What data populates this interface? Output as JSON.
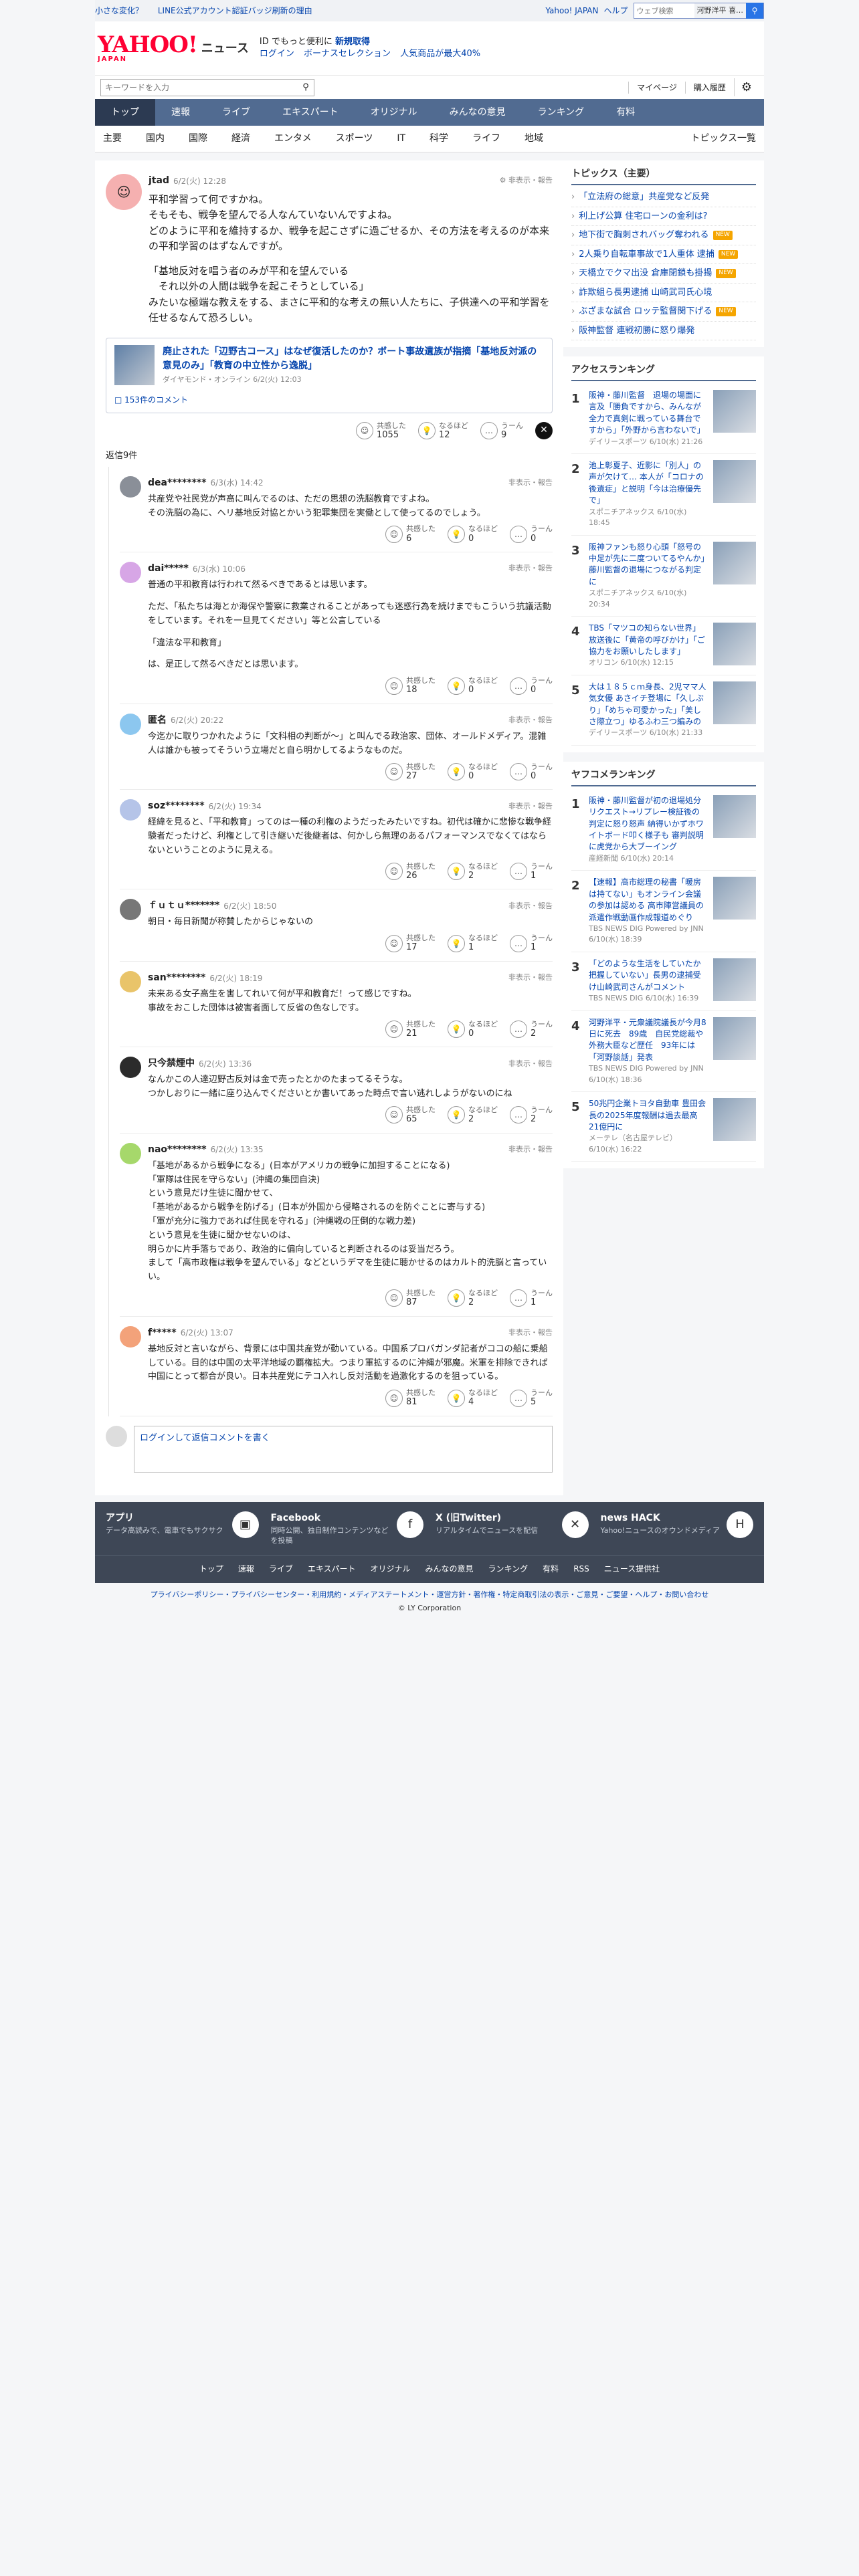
{
  "promo": {
    "left_links": [
      "小さな変化？",
      "LINE公式アカウント認証バッジ刷新の理由"
    ],
    "right_links": [
      "Yahoo! JAPAN",
      "ヘルプ"
    ],
    "search_placeholder": "ウェブ検索",
    "search_chip": "河野洋平 喜…"
  },
  "masthead": {
    "logo": "YAHOO!",
    "logo_sub": "JAPAN",
    "service": "ニュース",
    "line1_text": "ID でもっと便利に",
    "line1_link": "新規取得",
    "line2_login": "ログイン",
    "line2_bonus": "ボーナスセレクション",
    "line2_promo": "人気商品が最大40%"
  },
  "subbar": {
    "keyword_placeholder": "キーワードを入力",
    "mypage": "マイページ",
    "history": "購入履歴"
  },
  "gnav": [
    "トップ",
    "速報",
    "ライブ",
    "エキスパート",
    "オリジナル",
    "みんなの意見",
    "ランキング",
    "有料"
  ],
  "cnav": [
    "主要",
    "国内",
    "国際",
    "経済",
    "エンタメ",
    "スポーツ",
    "IT",
    "科学",
    "ライフ",
    "地域"
  ],
  "cnav_all": "トピックス一覧",
  "post": {
    "user": "jtad",
    "time": "6/2(火) 12:28",
    "report": "非表示・報告",
    "paragraphs": [
      "平和学習って何ですかね。",
      "そもそも、戦争を望んでる人なんていないんですよね。",
      "どのように平和を維持するか、戦争を起こさずに過ごせるか、その方法を考えるのが本来の平和学習のはずなんですが。",
      "",
      "「基地反対を唱う者のみが平和を望んでいる",
      "　それ以外の人間は戦争を起こそうとしている」",
      "みたいな極端な教えをする、まさに平和的な考えの無い人たちに、子供達への平和学習を任せるなんて恐ろしい。"
    ],
    "article": {
      "title": "廃止された「辺野古コース」はなぜ復活したのか？ボート事故遺族が指摘「基地反対派の意見のみ」「教育の中立性から逸脱」",
      "source": "ダイヤモンド・オンライン 6/2(火) 12:03",
      "comments": "153件のコメント"
    },
    "reactions": [
      {
        "label": "共感した",
        "count": "1055",
        "icon": "empathy-icon",
        "glyph": "☺"
      },
      {
        "label": "なるほど",
        "count": "12",
        "icon": "insight-icon",
        "glyph": "💡"
      },
      {
        "label": "うーん",
        "count": "9",
        "icon": "hmm-icon",
        "glyph": "…"
      }
    ]
  },
  "replies_heading": "返信9件",
  "replies": [
    {
      "user": "dea********",
      "time": "6/3(水) 14:42",
      "avatar_color": "#8a8f98",
      "lines": [
        "共産党や社民党が声高に叫んでるのは、ただの思想の洗脳教育ですよね。",
        "その洗脳の為に、ヘリ基地反対協とかいう犯罪集団を実働として使ってるのでしょう。"
      ],
      "r": [
        "6",
        "0",
        "0"
      ]
    },
    {
      "user": "dai*****",
      "time": "6/3(水) 10:06",
      "avatar_color": "#d7a6e6",
      "lines": [
        "普通の平和教育は行われて然るべきであるとは思います。",
        "",
        "ただ、「私たちは海とか海保や警察に救業されることがあっても迷惑行為を続けまでもこういう抗議活動をしています。それを一旦見てください」等と公言している",
        "",
        "「違法な平和教育」",
        "",
        "は、是正して然るべきだとは思います。"
      ],
      "r": [
        "18",
        "0",
        "0"
      ]
    },
    {
      "user": "匿名",
      "time": "6/2(火) 20:22",
      "avatar_color": "#8cc7ef",
      "lines": [
        "今迄かに取りつかれたように「文科相の判断が～」と叫んでる政治家、団体、オールドメディア。混雑人は誰かも被ってそういう立場だと自ら明かしてるようなものだ。"
      ],
      "r": [
        "27",
        "0",
        "0"
      ]
    },
    {
      "user": "soz********",
      "time": "6/2(火) 19:34",
      "avatar_color": "#b5c4e8",
      "lines": [
        "経緯を見ると、「平和教育」ってのは一種の利権のようだったみたいですね。初代は確かに悲惨な戦争経験者だったけど、利権として引き継いだ後継者は、何かしら無理のあるパフォーマンスでなくてはならないということのように見える。"
      ],
      "r": [
        "26",
        "2",
        "1"
      ]
    },
    {
      "user": "ｆｕｔｕ*******",
      "time": "6/2(火) 18:50",
      "avatar_color": "#777",
      "lines": [
        "朝日・毎日新聞が称賛したからじゃないの"
      ],
      "r": [
        "17",
        "1",
        "1"
      ]
    },
    {
      "user": "san********",
      "time": "6/2(火) 18:19",
      "avatar_color": "#e9c46a",
      "lines": [
        "未来ある女子高生を害してれいて何が平和教育だ！って感じですね。",
        "事故をおこした団体は被害者面して反省の色なしです。"
      ],
      "r": [
        "21",
        "0",
        "2"
      ]
    },
    {
      "user": "只今禁煙中",
      "time": "6/2(火) 13:36",
      "avatar_color": "#2b2b2b",
      "lines": [
        "なんかこの人達辺野古反対は金で売ったとかのたまってるそうな。",
        "つかしおりに一緒に座り込んでくださいとか書いてあった時点で言い逃れしようがないのにね"
      ],
      "r": [
        "65",
        "2",
        "2"
      ]
    },
    {
      "user": "nao********",
      "time": "6/2(火) 13:35",
      "avatar_color": "#a6d86b",
      "lines": [
        "「基地があるから戦争になる」(日本がアメリカの戦争に加担することになる)",
        "「軍隊は住民を守らない」(沖縄の集団自決)",
        "という意見だけ生徒に聞かせて、",
        "「基地があるから戦争を防げる」(日本が外国から侵略されるのを防ぐことに寄与する)",
        "「軍が充分に強力であれば住民を守れる」(沖縄戦の圧倒的な戦力差)",
        "という意見を生徒に聞かせないのは、",
        "明らかに片手落ちであり、政治的に偏向していると判断されるのは妥当だろう。",
        "まして「高市政権は戦争を望んでいる」などというデマを生徒に聴かせるのはカルト的洗脳と言っていい。"
      ],
      "r": [
        "87",
        "2",
        "1"
      ]
    },
    {
      "user": "f*****",
      "time": "6/2(火) 13:07",
      "avatar_color": "#f3a27a",
      "lines": [
        "基地反対と言いながら、背景には中国共産党が動いている。中国系プロパガンダ記者がココの船に乗船している。目的は中国の太平洋地域の覇権拡大。つまり軍拡するのに沖縄が邪魔。米軍を排除できれば中国にとって都合が良い。日本共産党にテコ入れし反対活動を過激化するのを狙っている。"
      ],
      "r": [
        "81",
        "4",
        "5"
      ]
    }
  ],
  "reply_labels": {
    "a": "共感した",
    "b": "なるほど",
    "c": "うーん"
  },
  "login_box": {
    "link": "ログイン",
    "text": "して返信コメントを書く"
  },
  "sidebar": {
    "topics_title": "トピックス（主要）",
    "topics": [
      {
        "t": "「立法府の総意」共産党など反発",
        "new": false
      },
      {
        "t": "利上げ公算 住宅ローンの金利は?",
        "new": false
      },
      {
        "t": "地下街で胸刺されバッグ奪われる",
        "new": true
      },
      {
        "t": "2人乗り自転車事故で1人重体 逮捕",
        "new": true
      },
      {
        "t": "天橋立でクマ出没 倉庫閉鎖も掛揚",
        "new": true
      },
      {
        "t": "詐欺組ら長男逮捕 山崎武司氏心境",
        "new": false
      },
      {
        "t": "ぶざまな試合 ロッテ監督関下げる",
        "new": true
      },
      {
        "t": "阪神監督 連戦初勝に怒り爆発",
        "new": false
      }
    ],
    "access_title": "アクセスランキング",
    "access": [
      {
        "n": "1",
        "t": "阪神・藤川監督　退場の場面に言及「勝負ですから、みんなが全力で真剣に戦っている舞台ですから」「外野から言わないで」",
        "s": "デイリースポーツ 6/10(水) 21:26"
      },
      {
        "n": "2",
        "t": "池上彰夏子、近影に「別人」の声が欠けて… 本人が「コロナの後遺症」と説明「今は治療優先で」",
        "s": "スポニチアネックス 6/10(水) 18:45"
      },
      {
        "n": "3",
        "t": "阪神ファンも怒り心頭「怒号の中足が先に二度ついてるやんか」藤川監督の退場につながる判定に",
        "s": "スポニチアネックス 6/10(水) 20:34"
      },
      {
        "n": "4",
        "t": "TBS「マツコの知らない世界」放送後に「黄帝の呼びかけ」「ご協力をお願いしたします」",
        "s": "オリコン 6/10(水) 12:15"
      },
      {
        "n": "5",
        "t": "大は１８５ｃｍ身長、2児ママ人気女優 あさイチ登場に「久しぶり」「めちゃ可愛かった」「美しさ際立つ」ゆるふわ三つ編みの",
        "s": "デイリースポーツ 6/10(水) 21:33"
      }
    ],
    "yahoo_title": "ヤフコメランキング",
    "yahoo": [
      {
        "n": "1",
        "t": "阪神・藤川監督が初の退場処分 リクエスト→リプレー検証後の判定に怒り怒声 納得いかずホワイトボード叩く様子も 審判説明に虎党から大ブーイング",
        "s": "産経新聞 6/10(水) 20:14"
      },
      {
        "n": "2",
        "t": "【速報】高市総理の秘書「暖房は持てない」もオンライン会議の参加は認める 高市陣営議員の派遣作戦動画作成報道めぐり",
        "s": "TBS NEWS DIG Powered by JNN 6/10(水) 18:39"
      },
      {
        "n": "3",
        "t": "「どのような生活をしていたか把握していない」長男の逮捕受け山崎武司さんがコメント",
        "s": "TBS NEWS DIG 6/10(水) 16:39"
      },
      {
        "n": "4",
        "t": "河野洋平・元衆議院議長が今月8日に死去　89歳　自民党総裁や外務大臣など歴任　93年には「河野談話」発表",
        "s": "TBS NEWS DIG Powered by JNN 6/10(水) 18:36"
      },
      {
        "n": "5",
        "t": "50兆円企業トヨタ自動車 豊田会長の2025年度報酬は過去最高21億円に",
        "s": "メーテレ（名古屋テレビ） 6/10(水) 16:22"
      }
    ]
  },
  "footer": {
    "apps": [
      {
        "title": "アプリ",
        "desc": "データ高読みで、電車でもサクサク",
        "icon": "app-icon",
        "glyph": "▣"
      },
      {
        "title": "Facebook",
        "desc": "同時公開、独自制作コンテンツなどを投稿",
        "icon": "facebook-icon",
        "glyph": "f"
      },
      {
        "title": "X (旧Twitter)",
        "desc": "リアルタイムでニュースを配信",
        "icon": "x-icon",
        "glyph": "✕"
      },
      {
        "title": "news HACK",
        "desc": "Yahoo!ニュースのオウンドメディア",
        "icon": "newshack-icon",
        "glyph": "H"
      }
    ],
    "links": [
      "トップ",
      "速報",
      "ライブ",
      "エキスパート",
      "オリジナル",
      "みんなの意見",
      "ランキング",
      "有料",
      "RSS",
      "ニュース提供社"
    ],
    "legal": "プライバシーポリシー・プライバシーセンター・利用規約・メディアステートメント・運営方針・著作権・特定商取引法の表示・ご意見・ご要望・ヘルプ・お問い合わせ",
    "copyright": "© LY Corporation"
  }
}
